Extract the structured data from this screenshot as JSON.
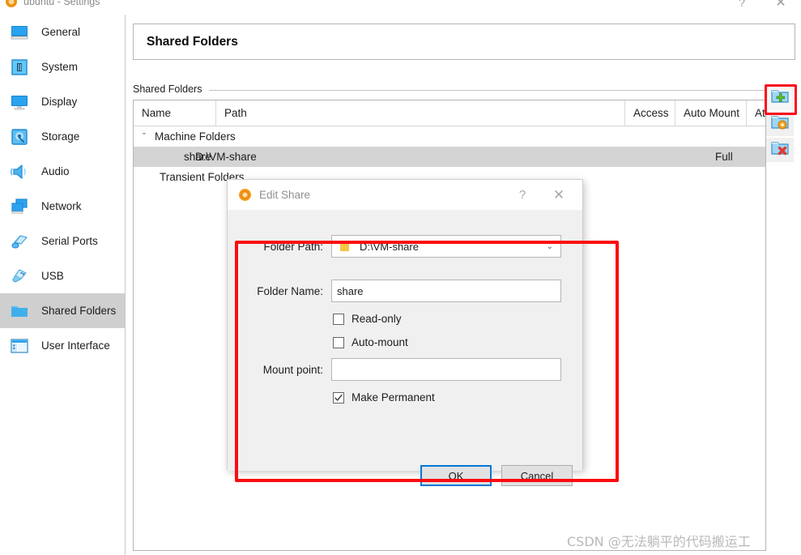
{
  "window": {
    "title": "ubuntu - Settings",
    "icon": "virtualbox-icon",
    "help_label": "?",
    "close_label": "✕"
  },
  "sidebar": {
    "items": [
      {
        "label": "General",
        "icon": "monitor-icon",
        "selected": false
      },
      {
        "label": "System",
        "icon": "motherboard-icon",
        "selected": false
      },
      {
        "label": "Display",
        "icon": "display-icon",
        "selected": false
      },
      {
        "label": "Storage",
        "icon": "harddisk-icon",
        "selected": false
      },
      {
        "label": "Audio",
        "icon": "speaker-icon",
        "selected": false
      },
      {
        "label": "Network",
        "icon": "network-icon",
        "selected": false
      },
      {
        "label": "Serial Ports",
        "icon": "serial-port-icon",
        "selected": false
      },
      {
        "label": "USB",
        "icon": "usb-icon",
        "selected": false
      },
      {
        "label": "Shared Folders",
        "icon": "folder-icon",
        "selected": true
      },
      {
        "label": "User Interface",
        "icon": "ui-window-icon",
        "selected": false
      }
    ]
  },
  "page": {
    "title": "Shared Folders",
    "group_label": "Shared Folders"
  },
  "table": {
    "columns": [
      "Name",
      "Path",
      "Access",
      "Auto Mount",
      "At"
    ],
    "groups": [
      {
        "label": "Machine Folders",
        "expanded": true,
        "expand_glyph": "ˇ",
        "rows": [
          {
            "name": "share",
            "path": "D:\\VM-share",
            "access": "Full",
            "auto_mount": "",
            "at": "",
            "selected": true
          }
        ]
      },
      {
        "label": "Transient Folders",
        "expanded": false,
        "expand_glyph": "",
        "rows": []
      }
    ]
  },
  "toolbar": {
    "buttons": [
      {
        "name": "add-shared-folder",
        "icon": "folder-add-icon",
        "highlighted": true
      },
      {
        "name": "edit-shared-folder",
        "icon": "folder-edit-icon",
        "highlighted": false
      },
      {
        "name": "remove-shared-folder",
        "icon": "folder-remove-icon",
        "highlighted": false
      }
    ]
  },
  "dialog": {
    "title": "Edit Share",
    "icon": "gear-icon",
    "help_label": "?",
    "close_label": "✕",
    "folder_path": {
      "label": "Folder Path:",
      "value": "D:\\VM-share",
      "icon": "folder-icon",
      "arrow": "⌄"
    },
    "folder_name": {
      "label": "Folder Name:",
      "value": "share",
      "placeholder": ""
    },
    "read_only": {
      "label": "Read-only",
      "checked": false
    },
    "auto_mount": {
      "label": "Auto-mount",
      "checked": false
    },
    "mount_point": {
      "label": "Mount point:",
      "value": "",
      "placeholder": ""
    },
    "make_permanent": {
      "label": "Make Permanent",
      "checked": true
    },
    "ok_label": "OK",
    "cancel_label": "Cancel"
  },
  "annotations": {
    "box_color": "#fd0b12",
    "toolbar_box_color": "#fc0d1b"
  },
  "watermark": {
    "text": "CSDN @无法躺平的代码搬运工"
  }
}
